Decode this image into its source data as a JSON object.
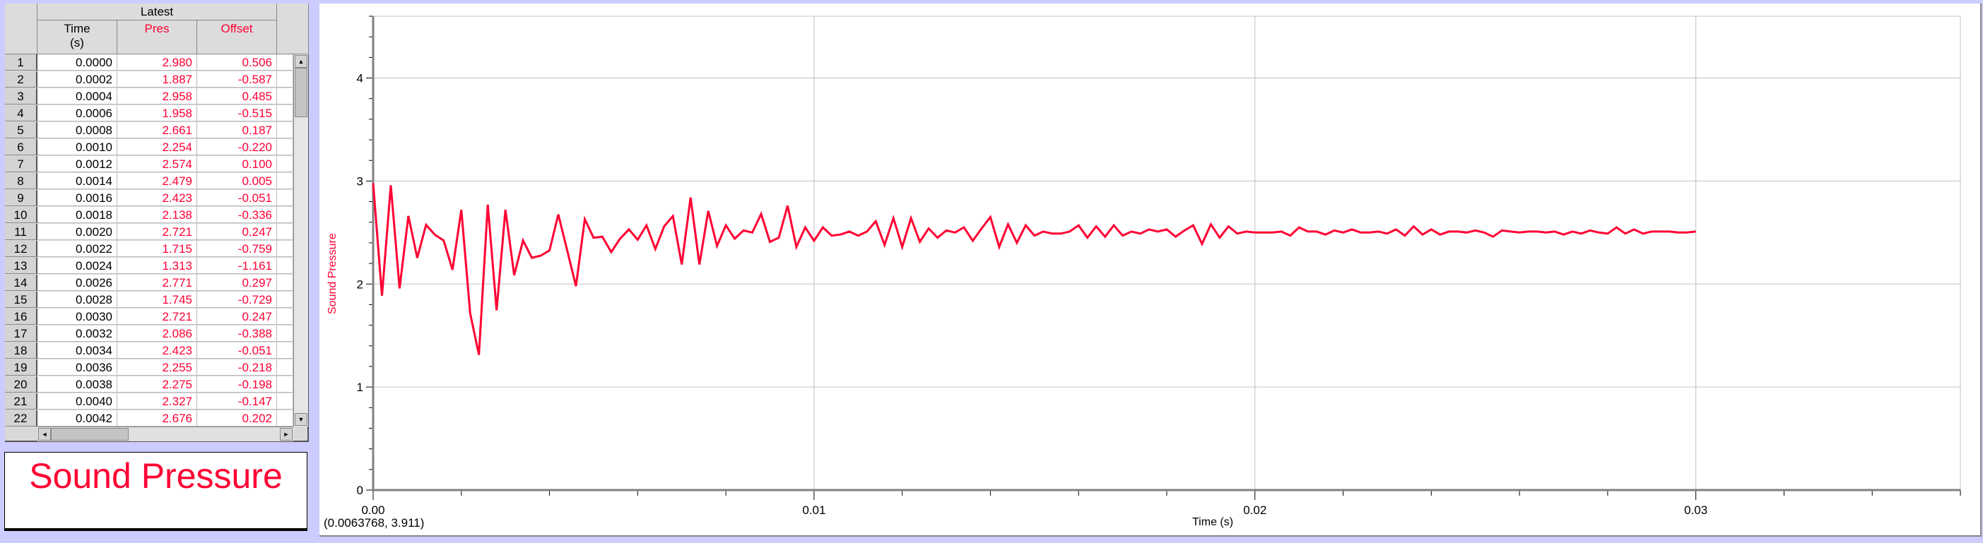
{
  "table": {
    "group_header": "Latest",
    "columns": [
      {
        "name": "Time",
        "unit": "(s)"
      },
      {
        "name": "Pres",
        "unit": ""
      },
      {
        "name": "Offset",
        "unit": ""
      }
    ],
    "rows": [
      [
        "1",
        "0.0000",
        "2.980",
        "0.506"
      ],
      [
        "2",
        "0.0002",
        "1.887",
        "-0.587"
      ],
      [
        "3",
        "0.0004",
        "2.958",
        "0.485"
      ],
      [
        "4",
        "0.0006",
        "1.958",
        "-0.515"
      ],
      [
        "5",
        "0.0008",
        "2.661",
        "0.187"
      ],
      [
        "6",
        "0.0010",
        "2.254",
        "-0.220"
      ],
      [
        "7",
        "0.0012",
        "2.574",
        "0.100"
      ],
      [
        "8",
        "0.0014",
        "2.479",
        "0.005"
      ],
      [
        "9",
        "0.0016",
        "2.423",
        "-0.051"
      ],
      [
        "10",
        "0.0018",
        "2.138",
        "-0.336"
      ],
      [
        "11",
        "0.0020",
        "2.721",
        "0.247"
      ],
      [
        "12",
        "0.0022",
        "1.715",
        "-0.759"
      ],
      [
        "13",
        "0.0024",
        "1.313",
        "-1.161"
      ],
      [
        "14",
        "0.0026",
        "2.771",
        "0.297"
      ],
      [
        "15",
        "0.0028",
        "1.745",
        "-0.729"
      ],
      [
        "16",
        "0.0030",
        "2.721",
        "0.247"
      ],
      [
        "17",
        "0.0032",
        "2.086",
        "-0.388"
      ],
      [
        "18",
        "0.0034",
        "2.423",
        "-0.051"
      ],
      [
        "19",
        "0.0036",
        "2.255",
        "-0.218"
      ],
      [
        "20",
        "0.0038",
        "2.275",
        "-0.198"
      ],
      [
        "21",
        "0.0040",
        "2.327",
        "-0.147"
      ],
      [
        "22",
        "0.0042",
        "2.676",
        "0.202"
      ]
    ],
    "scroll_icons": {
      "up": "arrow-up-icon",
      "down": "arrow-down-icon",
      "left": "arrow-left-icon",
      "right": "arrow-right-icon"
    }
  },
  "title_box": {
    "text": "Sound Pressure"
  },
  "colors": {
    "series": "#ff0033",
    "background": "#ccccff",
    "grid": "#c0c0c0"
  },
  "chart_data": {
    "type": "line",
    "xlabel": "Time (s)",
    "ylabel": "Sound Pressure",
    "xlim": [
      0,
      0.036
    ],
    "ylim": [
      0,
      4.6
    ],
    "x_ticks": [
      "0.00",
      "0.01",
      "0.02",
      "0.03"
    ],
    "y_ticks": [
      "0",
      "1",
      "2",
      "3",
      "4"
    ],
    "grid": true,
    "cursor_readout": "(0.0063768, 3.911)",
    "series": [
      {
        "color": "#ff0033",
        "x": [
          0,
          0.0002,
          0.0004,
          0.0006,
          0.0008,
          0.001,
          0.0012,
          0.0014,
          0.0016,
          0.0018,
          0.002,
          0.0022,
          0.0024,
          0.0026,
          0.0028,
          0.003,
          0.0032,
          0.0034,
          0.0036,
          0.0038,
          0.004,
          0.0042,
          0.0044,
          0.0046,
          0.0048,
          0.005,
          0.0052,
          0.0054,
          0.0056,
          0.0058,
          0.006,
          0.0062,
          0.0064,
          0.0066,
          0.0068,
          0.007,
          0.0072,
          0.0074,
          0.0076,
          0.0078,
          0.008,
          0.0082,
          0.0084,
          0.0086,
          0.0088,
          0.009,
          0.0092,
          0.0094,
          0.0096,
          0.0098,
          0.01,
          0.0102,
          0.0104,
          0.0106,
          0.0108,
          0.011,
          0.0112,
          0.0114,
          0.0116,
          0.0118,
          0.012,
          0.0122,
          0.0124,
          0.0126,
          0.0128,
          0.013,
          0.0132,
          0.0134,
          0.0136,
          0.0138,
          0.014,
          0.0142,
          0.0144,
          0.0146,
          0.0148,
          0.015,
          0.0152,
          0.0154,
          0.0156,
          0.0158,
          0.016,
          0.0162,
          0.0164,
          0.0166,
          0.0168,
          0.017,
          0.0172,
          0.0174,
          0.0176,
          0.0178,
          0.018,
          0.0182,
          0.0184,
          0.0186,
          0.0188,
          0.019,
          0.0192,
          0.0194,
          0.0196,
          0.0198,
          0.02,
          0.0202,
          0.0204,
          0.0206,
          0.0208,
          0.021,
          0.0212,
          0.0214,
          0.0216,
          0.0218,
          0.022,
          0.0222,
          0.0224,
          0.0226,
          0.0228,
          0.023,
          0.0232,
          0.0234,
          0.0236,
          0.0238,
          0.024,
          0.0242,
          0.0244,
          0.0246,
          0.0248,
          0.025,
          0.0252,
          0.0254,
          0.0256,
          0.0258,
          0.026,
          0.0262,
          0.0264,
          0.0266,
          0.0268,
          0.027,
          0.0272,
          0.0274,
          0.0276,
          0.0278,
          0.028,
          0.0282,
          0.0284,
          0.0286,
          0.0288,
          0.029,
          0.0292,
          0.0294,
          0.0296,
          0.0298,
          0.03
        ],
        "y": [
          2.98,
          1.887,
          2.958,
          1.958,
          2.661,
          2.254,
          2.574,
          2.479,
          2.423,
          2.138,
          2.721,
          1.715,
          1.313,
          2.771,
          1.745,
          2.721,
          2.086,
          2.423,
          2.255,
          2.275,
          2.327,
          2.676,
          2.33,
          1.98,
          2.63,
          2.45,
          2.46,
          2.31,
          2.44,
          2.53,
          2.43,
          2.57,
          2.34,
          2.56,
          2.66,
          2.19,
          2.84,
          2.19,
          2.71,
          2.37,
          2.57,
          2.44,
          2.52,
          2.5,
          2.68,
          2.41,
          2.45,
          2.76,
          2.36,
          2.55,
          2.42,
          2.55,
          2.47,
          2.48,
          2.51,
          2.47,
          2.51,
          2.61,
          2.38,
          2.64,
          2.36,
          2.64,
          2.41,
          2.54,
          2.45,
          2.52,
          2.5,
          2.55,
          2.42,
          2.54,
          2.65,
          2.36,
          2.58,
          2.4,
          2.57,
          2.47,
          2.51,
          2.49,
          2.49,
          2.51,
          2.57,
          2.45,
          2.56,
          2.46,
          2.57,
          2.47,
          2.51,
          2.49,
          2.53,
          2.51,
          2.53,
          2.46,
          2.52,
          2.57,
          2.39,
          2.58,
          2.45,
          2.56,
          2.49,
          2.51,
          2.5,
          2.5,
          2.5,
          2.51,
          2.47,
          2.55,
          2.51,
          2.51,
          2.48,
          2.52,
          2.5,
          2.53,
          2.5,
          2.5,
          2.51,
          2.49,
          2.53,
          2.47,
          2.56,
          2.48,
          2.53,
          2.48,
          2.51,
          2.51,
          2.5,
          2.52,
          2.5,
          2.46,
          2.52,
          2.51,
          2.5,
          2.51,
          2.51,
          2.5,
          2.51,
          2.48,
          2.51,
          2.49,
          2.52,
          2.5,
          2.49,
          2.55,
          2.49,
          2.53,
          2.49,
          2.51,
          2.51,
          2.51,
          2.5,
          2.5,
          2.51
        ]
      }
    ]
  }
}
